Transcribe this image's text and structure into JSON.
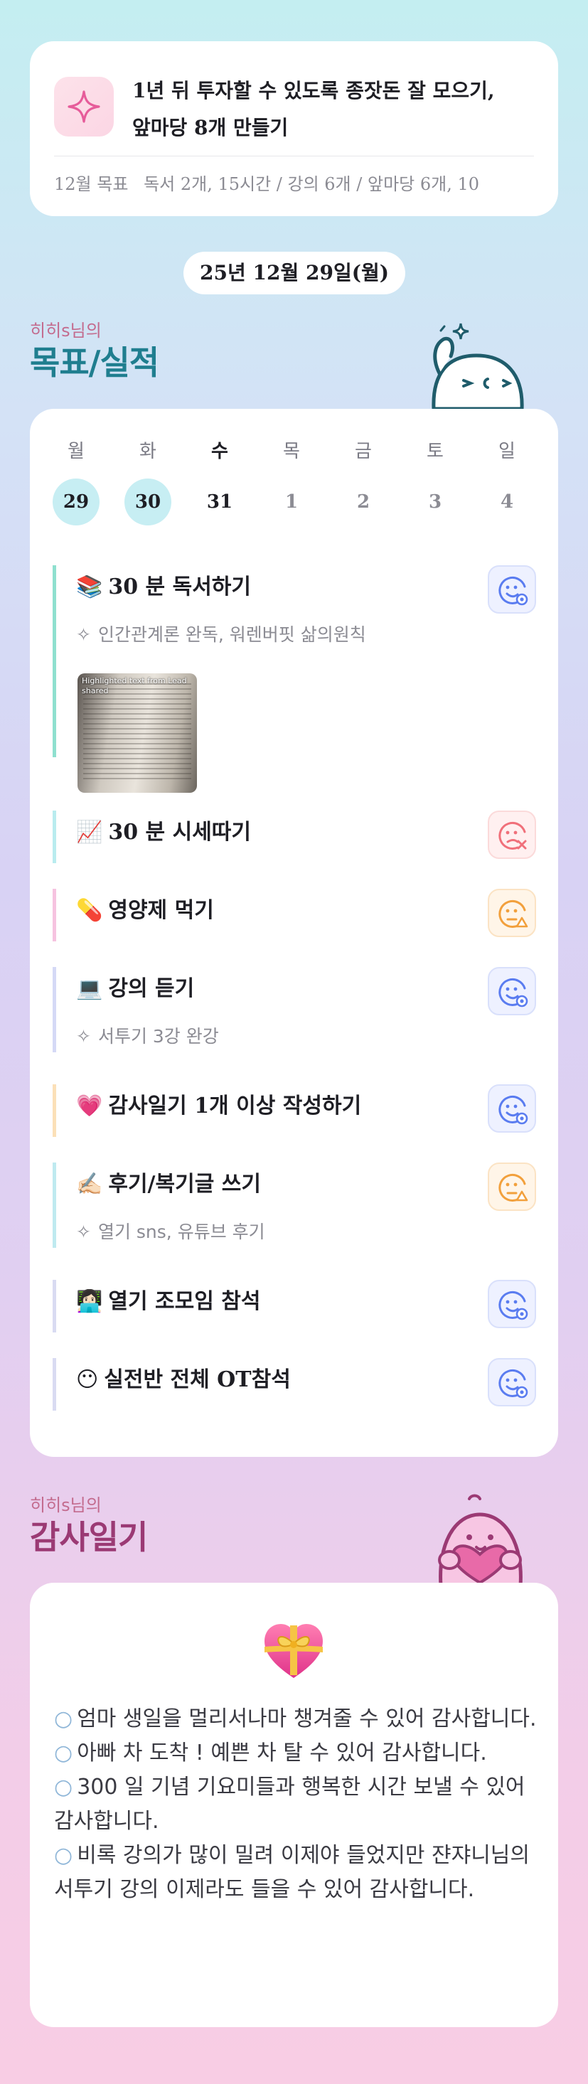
{
  "goal": {
    "icon": "sparkle-icon",
    "title_line1": "1년 뒤 투자할 수 있도록 종잣돈 잘 모으기,",
    "title_line2": "앞마당 8개 만들기",
    "monthly_label": "12월 목표",
    "monthly_text": "독서 2개, 15시간 / 강의 6개 / 앞마당 6개, 10"
  },
  "date_label": "25년 12월 29일(월)",
  "record_section": {
    "owner": "히히s님의",
    "title": "목표/실적"
  },
  "calendar": {
    "days": [
      {
        "name": "월",
        "num": "29",
        "state": "done"
      },
      {
        "name": "화",
        "num": "30",
        "state": "done"
      },
      {
        "name": "수",
        "num": "31",
        "state": "today"
      },
      {
        "name": "목",
        "num": "1",
        "state": "future"
      },
      {
        "name": "금",
        "num": "2",
        "state": "future"
      },
      {
        "name": "토",
        "num": "3",
        "state": "future"
      },
      {
        "name": "일",
        "num": "4",
        "state": "future"
      }
    ]
  },
  "habits": [
    {
      "emoji": "📚",
      "title": "30 분 독서하기",
      "memo": "인간관계론 완독, 워렌버핏 삶의원칙",
      "status": "good",
      "color": "#8fe0cf",
      "has_photo": true
    },
    {
      "emoji": "📈",
      "title": "30 분 시세따기",
      "memo": "",
      "status": "bad",
      "color": "#b9ecef"
    },
    {
      "emoji": "💊",
      "title": "영양제 먹기",
      "memo": "",
      "status": "warn",
      "color": "#f6c3e0"
    },
    {
      "emoji": "💻",
      "title": "강의 듣기",
      "memo": "서투기 3강 완강",
      "status": "good",
      "color": "#d5d9f6"
    },
    {
      "emoji": "💗",
      "title": "감사일기 1개 이상 작성하기",
      "memo": "",
      "status": "good",
      "color": "#fbe0b8"
    },
    {
      "emoji": "✍🏻",
      "title": "후기/복기글 쓰기",
      "memo": "열기 sns, 유튜브 후기",
      "status": "warn",
      "color": "#bfeaf0"
    },
    {
      "emoji": "👩🏻‍💻",
      "title": "열기 조모임 참석",
      "memo": "",
      "status": "good",
      "color": "#d9dbf2"
    },
    {
      "emoji": "😶",
      "title": "실전반 전체 OT참석",
      "memo": "",
      "status": "good",
      "color": "#d9dbf2"
    }
  ],
  "photo_caption": "Highlighted text from Lead shared",
  "gratitude_section": {
    "owner": "히히s님의",
    "title": "감사일기",
    "icon": "heart-gift-icon",
    "items": [
      "엄마 생일을 멀리서나마 챙겨줄 수 있어 감사합니다.",
      "아빠 차 도착 ! 예쁜 차 탈 수 있어 감사합니다.",
      "300 일 기념 기요미들과 행복한 시간 보낼 수 있어 감사합니다.",
      "비록 강의가 많이 밀려 이제야 들었지만 쟌쟈니님의 서투기 강의 이제라도 들을 수 있어 감사합니다."
    ]
  },
  "colors": {
    "good": "#5a7cf0",
    "bad": "#f0707a",
    "warn": "#f2a03c",
    "teal_heading": "#1f7e8f",
    "plum_heading": "#9b3a74"
  }
}
